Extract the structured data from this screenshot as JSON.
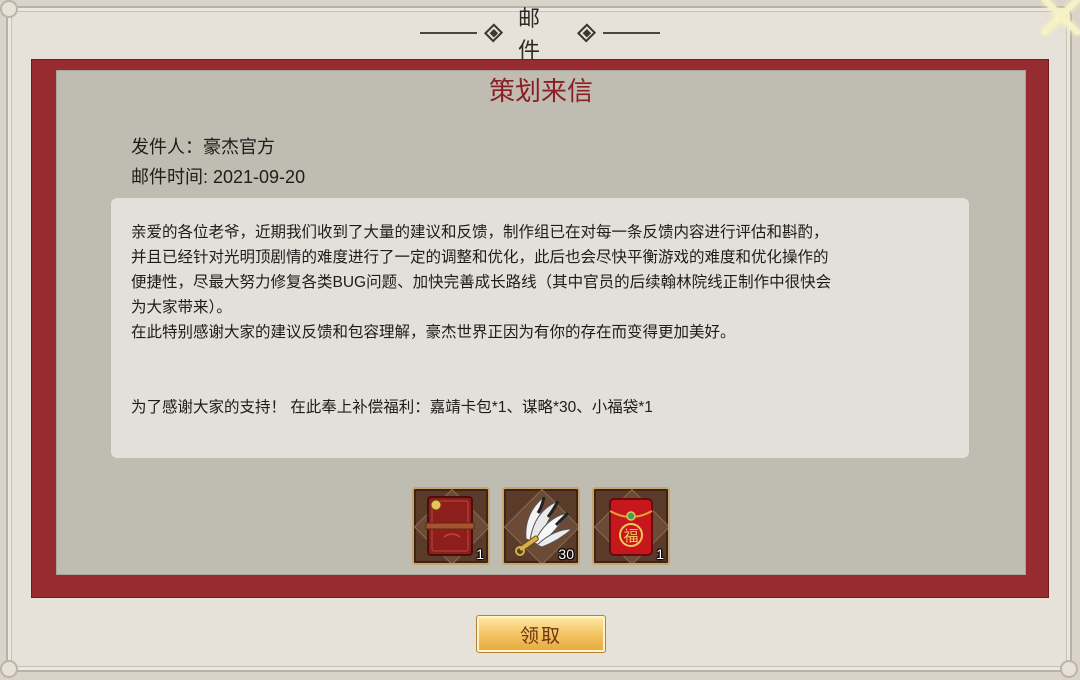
{
  "window": {
    "title": "邮件"
  },
  "mail": {
    "subject": "策划来信",
    "sender": "发件人：豪杰官方",
    "time": "邮件时间: 2021-09-20",
    "body_lines": [
      "亲爱的各位老爷，近期我们收到了大量的建议和反馈，制作组已在对每一条反馈内容进行评估和斟酌，",
      "并且已经针对光明顶剧情的难度进行了一定的调整和优化，此后也会尽快平衡游戏的难度和优化操作的",
      "便捷性，尽最大努力修复各类BUG问题、加快完善成长路线（其中官员的后续翰林院线正制作中很快会",
      "为大家带来）。",
      "在此特别感谢大家的建议反馈和包容理解，豪杰世界正因为有你的存在而变得更加美好。",
      "",
      "",
      "为了感谢大家的支持！ 在此奉上补偿福利：嘉靖卡包*1、谋略*30、小福袋*1"
    ]
  },
  "rewards": [
    {
      "icon": "card-pack-icon",
      "count": "1"
    },
    {
      "icon": "feather-fan-icon",
      "count": "30"
    },
    {
      "icon": "lucky-bag-icon",
      "count": "1"
    }
  ],
  "actions": {
    "claim_label": "领取"
  },
  "colors": {
    "frame_red": "#962c30",
    "title_red": "#8c1f24",
    "button_gold": "#f2c25f"
  }
}
